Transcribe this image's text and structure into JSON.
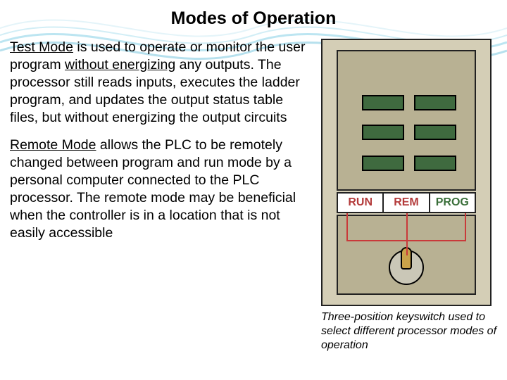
{
  "title": "Modes of Operation",
  "paragraphs": {
    "test": {
      "mode_name": "Test Mode",
      "rest": " is used to operate or monitor the user program ",
      "underline2": "without energizing",
      "tail": " any outputs. The processor still reads inputs, executes the ladder program, and updates the output status table files, but without energizing the output circuits"
    },
    "remote": {
      "mode_name": "Remote Mode",
      "rest": " allows the PLC to be remotely changed between program and run mode by a personal computer connected to the PLC processor. The remote mode may be beneficial when the controller is in a location that is not easily accessible"
    }
  },
  "diagram": {
    "labels": {
      "run": "RUN",
      "rem": "REM",
      "prog": "PROG"
    }
  },
  "caption": "Three-position keyswitch used to select different processor modes of operation"
}
